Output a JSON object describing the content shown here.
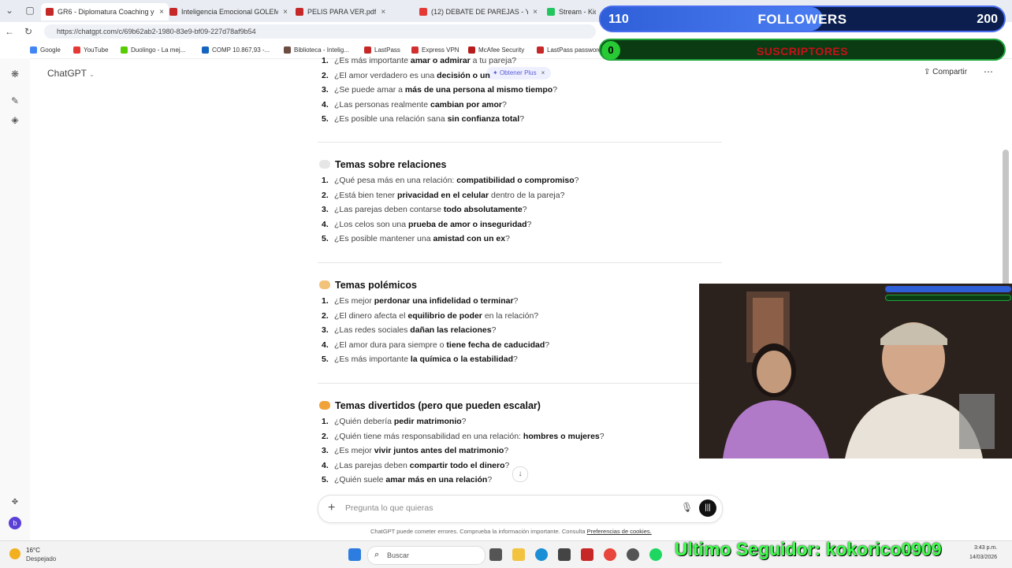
{
  "browser": {
    "tabs": [
      {
        "label": "GR6 - Diplomatura Coaching y Lid",
        "color": "#c62828",
        "active": true
      },
      {
        "label": "Inteligencia Emocional GOLEMAN",
        "color": "#c62828",
        "active": false
      },
      {
        "label": "PELIS PARA VER.pdf",
        "color": "#c62828",
        "active": false
      },
      {
        "label": "(12) DEBATE DE PAREJAS - YouTub",
        "color": "#e53935",
        "active": false
      },
      {
        "label": "Stream - Kick",
        "color": "#22c55e",
        "active": false
      }
    ],
    "url": "https://chatgpt.com/c/69b62ab2-1980-83e9-bf09-227d78af9b54",
    "bookmarks": [
      {
        "label": "Google",
        "color": "#4285f4"
      },
      {
        "label": "YouTube",
        "color": "#e53935"
      },
      {
        "label": "Duolingo - La mej...",
        "color": "#58cc02"
      },
      {
        "label": "COMP 10.867,93 -...",
        "color": "#1565c0"
      },
      {
        "label": "Biblioteca - Intelig...",
        "color": "#6d4c41"
      },
      {
        "label": "LastPass",
        "color": "#c62828"
      },
      {
        "label": "Express VPN",
        "color": "#d32f2f"
      },
      {
        "label": "McAfee Security",
        "color": "#b71c1c"
      },
      {
        "label": "LastPass password",
        "color": "#c62828"
      },
      {
        "label": "AJEDREZ",
        "color": "#7cb342"
      },
      {
        "label": "Otros favoritos",
        "color": "#888888"
      }
    ]
  },
  "app": {
    "title": "ChatGPT",
    "obtener_plus": "Obtener Plus",
    "share": "Compartir",
    "composer_placeholder": "Pregunta lo que quieras",
    "footer_text": "ChatGPT puede cometer errores. Comprueba la información importante. Consulta",
    "footer_link": "Preferencias de cookies."
  },
  "content": {
    "top_list": [
      {
        "n": "1.",
        "pre": "¿Es más importante ",
        "b": "amar o admirar",
        "post": " a tu pareja?"
      },
      {
        "n": "2.",
        "pre": "¿El amor verdadero es una ",
        "b": "decisión o un",
        "post": ""
      },
      {
        "n": "3.",
        "pre": "¿Se puede amar a ",
        "b": "más de una persona al mismo tiempo",
        "post": "?"
      },
      {
        "n": "4.",
        "pre": "¿Las personas realmente ",
        "b": "cambian por amor",
        "post": "?"
      },
      {
        "n": "5.",
        "pre": "¿Es posible una relación sana ",
        "b": "sin confianza total",
        "post": "?"
      }
    ],
    "sections": [
      {
        "title": "Temas sobre relaciones",
        "emoji_color": "#e6e6e6",
        "items": [
          {
            "n": "1.",
            "pre": "¿Qué pesa más en una relación: ",
            "b": "compatibilidad o compromiso",
            "post": "?"
          },
          {
            "n": "2.",
            "pre": "¿Está bien tener ",
            "b": "privacidad en el celular",
            "post": " dentro de la pareja?"
          },
          {
            "n": "3.",
            "pre": "¿Las parejas deben contarse ",
            "b": "todo absolutamente",
            "post": "?"
          },
          {
            "n": "4.",
            "pre": "¿Los celos son una ",
            "b": "prueba de amor o inseguridad",
            "post": "?"
          },
          {
            "n": "5.",
            "pre": "¿Es posible mantener una ",
            "b": "amistad con un ex",
            "post": "?"
          }
        ]
      },
      {
        "title": "Temas polémicos",
        "emoji_color": "#f3c27a",
        "items": [
          {
            "n": "1.",
            "pre": "¿Es mejor ",
            "b": "perdonar una infidelidad o terminar",
            "post": "?"
          },
          {
            "n": "2.",
            "pre": "¿El dinero afecta el ",
            "b": "equilibrio de poder",
            "post": " en la relación?"
          },
          {
            "n": "3.",
            "pre": "¿Las redes sociales ",
            "b": "dañan las relaciones",
            "post": "?"
          },
          {
            "n": "4.",
            "pre": "¿El amor dura para siempre o ",
            "b": "tiene fecha de caducidad",
            "post": "?"
          },
          {
            "n": "5.",
            "pre": "¿Es más importante ",
            "b": "la química o la estabilidad",
            "post": "?"
          }
        ]
      },
      {
        "title": "Temas divertidos (pero que pueden escalar)",
        "emoji_color": "#f0a23b",
        "items": [
          {
            "n": "1.",
            "pre": "¿Quién debería ",
            "b": "pedir matrimonio",
            "post": "?"
          },
          {
            "n": "2.",
            "pre": "¿Quién tiene más responsabilidad en una relación: ",
            "b": "hombres o mujeres",
            "post": "?"
          },
          {
            "n": "3.",
            "pre": "¿Es mejor ",
            "b": "vivir juntos antes del matrimonio",
            "post": "?"
          },
          {
            "n": "4.",
            "pre": "¿Las parejas deben ",
            "b": "compartir todo el dinero",
            "post": "?"
          },
          {
            "n": "5.",
            "pre": "¿Quién suele ",
            "b": "amar más en una relación",
            "post": "?"
          }
        ]
      }
    ]
  },
  "taskbar": {
    "weather_temp": "16°C",
    "weather_desc": "Despejado",
    "search_placeholder": "Buscar",
    "lang": "LAA",
    "time": "3:43 p.m.",
    "date": "14/03/2026"
  },
  "overlay": {
    "followers_current": "110",
    "followers_label": "FOLLOWERS",
    "followers_goal": "200",
    "followers_progress": 0.55,
    "subs_current": "0",
    "subs_label": "SUSCRIPTORES",
    "last_follower": "Ultimo Seguidor: kokorico0909"
  },
  "colors": {
    "accent": "#5b5bd6",
    "followers_bar": "#2f5fd8",
    "subs_bar": "#1ea33a",
    "last_follower_text": "#3cff4a"
  }
}
